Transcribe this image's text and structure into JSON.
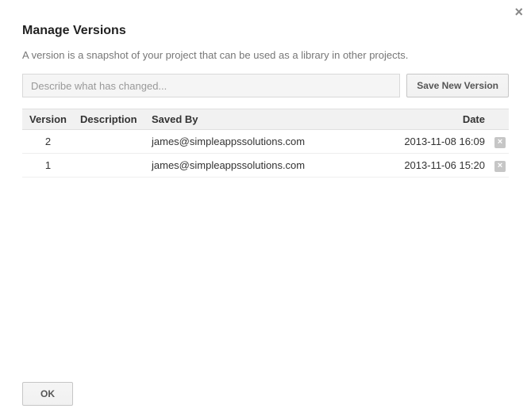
{
  "close_glyph": "×",
  "title": "Manage Versions",
  "subtitle": "A version is a snapshot of your project that can be used as a library in other projects.",
  "describe_placeholder": "Describe what has changed...",
  "save_button_label": "Save New Version",
  "columns": {
    "version": "Version",
    "description": "Description",
    "saved_by": "Saved By",
    "date": "Date"
  },
  "rows": [
    {
      "version": "2",
      "description": "",
      "saved_by": "james@simpleappssolutions.com",
      "date": "2013-11-08 16:09"
    },
    {
      "version": "1",
      "description": "",
      "saved_by": "james@simpleappssolutions.com",
      "date": "2013-11-06 15:20"
    }
  ],
  "delete_glyph": "×",
  "ok_label": "OK"
}
